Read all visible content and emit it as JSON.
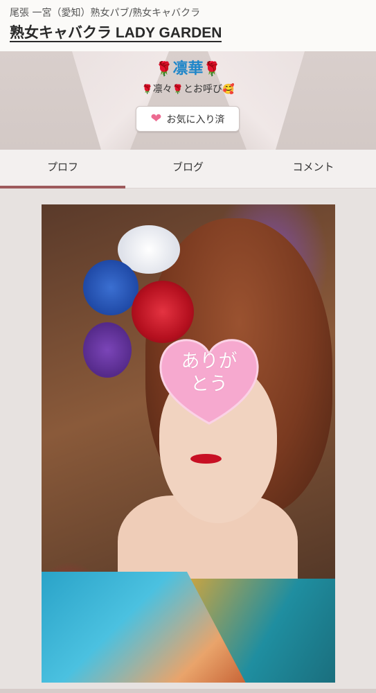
{
  "header": {
    "breadcrumb": "尾張 一宮（愛知）熟女パブ/熟女キャバクラ",
    "shop_title": "熟女キャバクラ LADY GARDEN"
  },
  "profile": {
    "rose_icon": "🌹",
    "name": "凛華",
    "catch_prefix": "凛々",
    "catch_suffix": "とお呼び",
    "catch_emoji": "🥰",
    "favorite_label": "お気に入り済",
    "heart_icon": "❤"
  },
  "tabs": [
    {
      "label": "プロフ",
      "active": true
    },
    {
      "label": "ブログ",
      "active": false
    },
    {
      "label": "コメント",
      "active": false
    }
  ],
  "photo": {
    "sticker_line1": "ありが",
    "sticker_line2": "とう",
    "sticker_color": "#f6a9cf"
  }
}
